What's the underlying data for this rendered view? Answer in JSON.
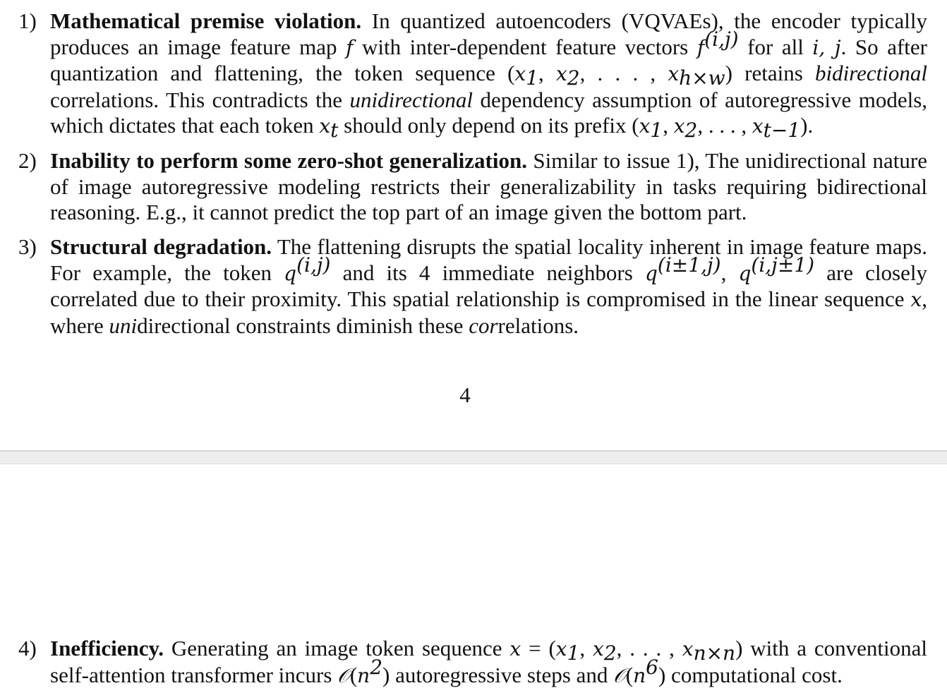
{
  "items": [
    {
      "number": "1)",
      "title": "Mathematical premise violation.",
      "segments": [
        {
          "t": "In quantized autoencoders (VQVAEs), the encoder typically produces an image feature map "
        },
        {
          "m": "f"
        },
        {
          "t": " with inter-dependent feature vectors "
        },
        {
          "m": "f",
          "sup": "(i,j)"
        },
        {
          "t": " for all "
        },
        {
          "m": "i, j"
        },
        {
          "t": ". So after quantization and flattening, the token sequence ("
        },
        {
          "m": "x",
          "sub": "1"
        },
        {
          "t": ", "
        },
        {
          "m": "x",
          "sub": "2"
        },
        {
          "t": ", . . . , "
        },
        {
          "m": "x",
          "sub": "h×w"
        },
        {
          "t": ") retains "
        },
        {
          "i": "bidirectional"
        },
        {
          "t": " correlations. This contradicts the "
        },
        {
          "i": "unidirectional"
        },
        {
          "t": " dependency assumption of autoregressive models, which dictates that each token "
        },
        {
          "m": "x",
          "sub": "t"
        },
        {
          "t": " should only depend on its prefix ("
        },
        {
          "m": "x",
          "sub": "1"
        },
        {
          "t": ", "
        },
        {
          "m": "x",
          "sub": "2"
        },
        {
          "t": ", . . . , "
        },
        {
          "m": "x",
          "sub": "t−1"
        },
        {
          "t": ")."
        }
      ]
    },
    {
      "number": "2)",
      "title": "Inability to perform some zero-shot generalization.",
      "segments": [
        {
          "t": "Similar to issue 1), The unidirectional nature of image autoregressive modeling restricts their generalizability in tasks requiring bidirectional reasoning. E.g., it cannot predict the top part of an image given the bottom part."
        }
      ]
    },
    {
      "number": "3)",
      "title": "Structural degradation.",
      "segments": [
        {
          "t": "The flattening disrupts the spatial locality inherent in image feature maps. For example, the token "
        },
        {
          "m": "q",
          "sup": "(i,j)"
        },
        {
          "t": " and its 4 immediate neighbors "
        },
        {
          "m": "q",
          "sup": "(i±1,j)"
        },
        {
          "t": ", "
        },
        {
          "m": "q",
          "sup": "(i,j±1)"
        },
        {
          "t": " are closely correlated due to their proximity. This spatial relationship is compromised in the linear sequence "
        },
        {
          "m": "x"
        },
        {
          "t": ", where "
        },
        {
          "i": "uni"
        },
        {
          "t": "directional constraints diminish these "
        },
        {
          "i": "cor"
        },
        {
          "t": "relations."
        }
      ]
    },
    {
      "number": "4)",
      "title": "Inefficiency.",
      "segments": [
        {
          "t": "Generating an image token sequence "
        },
        {
          "m": "x"
        },
        {
          "t": " = ("
        },
        {
          "m": "x",
          "sub": "1"
        },
        {
          "t": ", "
        },
        {
          "m": "x",
          "sub": "2"
        },
        {
          "t": ", . . . , "
        },
        {
          "m": "x",
          "sub": "n×n"
        },
        {
          "t": ") with a conventional self-attention transformer incurs "
        },
        {
          "m": "𝒪"
        },
        {
          "t": "("
        },
        {
          "m": "n",
          "sup": "2"
        },
        {
          "t": ") autoregressive steps and "
        },
        {
          "m": "𝒪"
        },
        {
          "t": "("
        },
        {
          "m": "n",
          "sup": "6"
        },
        {
          "t": ") computational cost."
        }
      ]
    }
  ],
  "page_number": "4"
}
